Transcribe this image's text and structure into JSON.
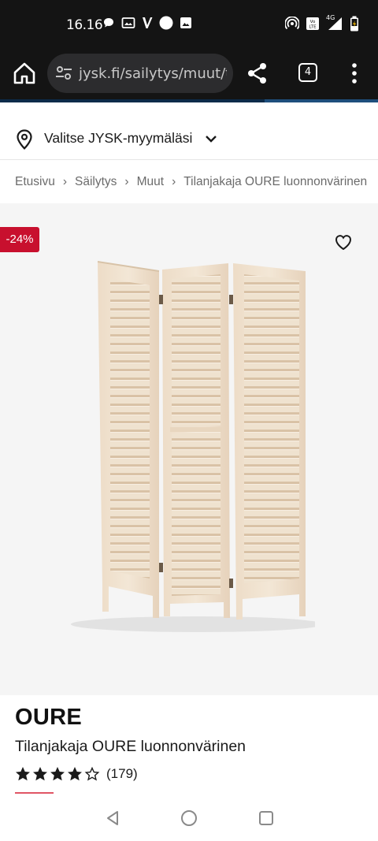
{
  "status_bar": {
    "time": "16.16",
    "network_label": "4G"
  },
  "browser": {
    "url": "jysk.fi/sailytys/muut/ti",
    "tab_count": "4"
  },
  "store_selector": {
    "label": "Valitse JYSK-myymälä​si"
  },
  "breadcrumb": {
    "items": [
      "Etusivu",
      "Säilytys",
      "Muut",
      "Tilanjakaja OURE luonnonvärinen"
    ],
    "separator": "›"
  },
  "product": {
    "discount_badge": "-24%",
    "brand": "OURE",
    "name": "Tilanjakaja OURE luonnonvärinen",
    "rating": 4,
    "rating_max": 5,
    "review_count": "(179)",
    "image_icon": "room-divider-image"
  },
  "colors": {
    "brand_red": "#c8102e",
    "status_bg": "#141414"
  }
}
